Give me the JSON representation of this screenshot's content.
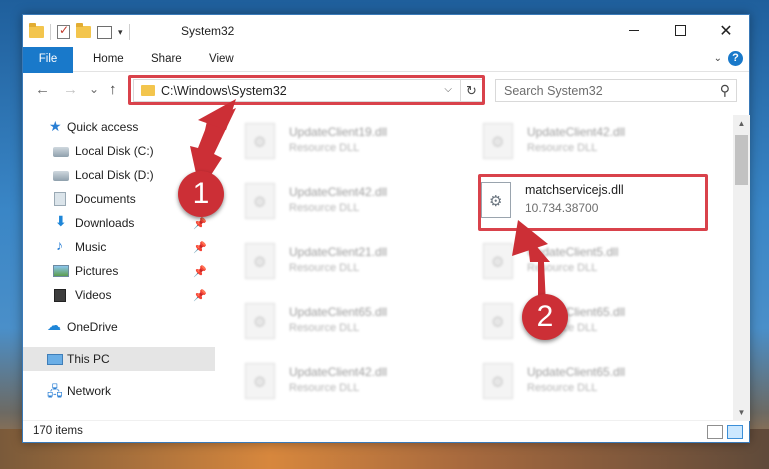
{
  "window": {
    "title": "System32",
    "controls": {
      "minimize": "",
      "maximize": "",
      "close": "✕"
    }
  },
  "ribbon": {
    "tabs": [
      "File",
      "Home",
      "Share",
      "View"
    ]
  },
  "address_bar": {
    "path": "C:\\Windows\\System32",
    "dropdown": "⌵",
    "refresh": "↻"
  },
  "search": {
    "placeholder": "Search System32",
    "icon": "⚲"
  },
  "nav_buttons": {
    "back": "←",
    "forward": "→",
    "recent": "⌄",
    "up": "↑"
  },
  "sidebar": {
    "items": [
      {
        "label": "Quick access",
        "icon": "star-icon",
        "pinned": false
      },
      {
        "label": "Local Disk (C:)",
        "icon": "disk-icon",
        "pinned": true
      },
      {
        "label": "Local Disk (D:)",
        "icon": "disk-icon",
        "pinned": true
      },
      {
        "label": "Documents",
        "icon": "documents-icon",
        "pinned": true
      },
      {
        "label": "Downloads",
        "icon": "downloads-icon",
        "pinned": true
      },
      {
        "label": "Music",
        "icon": "music-icon",
        "pinned": true
      },
      {
        "label": "Pictures",
        "icon": "pictures-icon",
        "pinned": true
      },
      {
        "label": "Videos",
        "icon": "videos-icon",
        "pinned": true
      },
      {
        "label": "OneDrive",
        "icon": "onedrive-icon",
        "pinned": false
      },
      {
        "label": "This PC",
        "icon": "this-pc-icon",
        "pinned": false,
        "selected": true
      },
      {
        "label": "Network",
        "icon": "network-icon",
        "pinned": false
      }
    ]
  },
  "files": {
    "left": [
      {
        "name": "UpdateClient19.dll",
        "desc": "Resource DLL"
      },
      {
        "name": "UpdateClient42.dll",
        "desc": "Resource DLL"
      },
      {
        "name": "UpdateClient21.dll",
        "desc": "Resource DLL"
      },
      {
        "name": "UpdateClient65.dll",
        "desc": "Resource DLL"
      },
      {
        "name": "UpdateClient42.dll",
        "desc": "Resource DLL"
      }
    ],
    "right": [
      {
        "name": "UpdateClient42.dll",
        "desc": "Resource DLL"
      },
      {
        "name": "matchservicejs.dll",
        "desc": "10.734.38700",
        "highlighted": true
      },
      {
        "name": "UpdateClient5.dll",
        "desc": "Resource DLL"
      },
      {
        "name": "UpdateClient65.dll",
        "desc": "Resource DLL"
      },
      {
        "name": "UpdateClient65.dll",
        "desc": "Resource DLL"
      }
    ]
  },
  "status": {
    "count": "170 items"
  },
  "annotations": {
    "step1": "1",
    "step2": "2",
    "color": "#cc2f36"
  },
  "colors": {
    "accent": "#1979ca",
    "selection": "#cce8ff",
    "highlight_border": "#d9424b"
  }
}
